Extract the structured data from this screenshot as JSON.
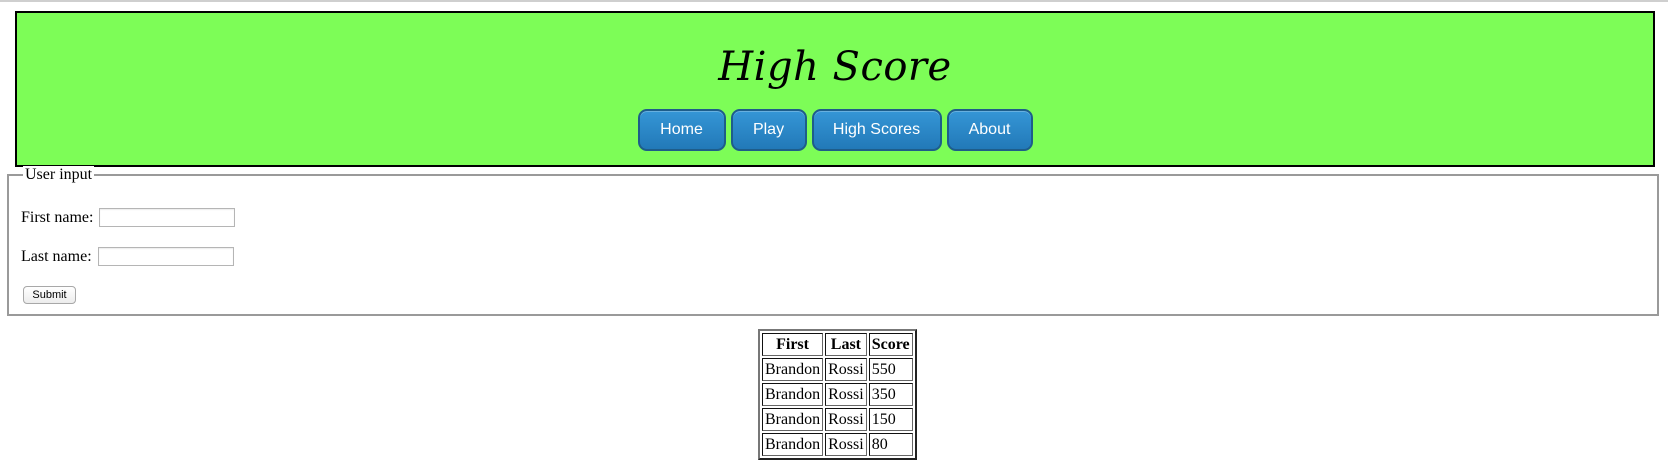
{
  "header": {
    "title": "High Score",
    "background_color": "#7dfd57",
    "nav": [
      {
        "label": "Home"
      },
      {
        "label": "Play"
      },
      {
        "label": "High Scores"
      },
      {
        "label": "About"
      }
    ],
    "nav_button_color": "#2a86c7"
  },
  "form": {
    "legend": "User input",
    "first_name_label": "First name:",
    "first_name_value": "",
    "last_name_label": "Last name:",
    "last_name_value": "",
    "submit_label": "Submit"
  },
  "scores": {
    "columns": [
      "First",
      "Last",
      "Score"
    ],
    "rows": [
      [
        "Brandon",
        "Rossi",
        "550"
      ],
      [
        "Brandon",
        "Rossi",
        "350"
      ],
      [
        "Brandon",
        "Rossi",
        "150"
      ],
      [
        "Brandon",
        "Rossi",
        "80"
      ]
    ]
  }
}
